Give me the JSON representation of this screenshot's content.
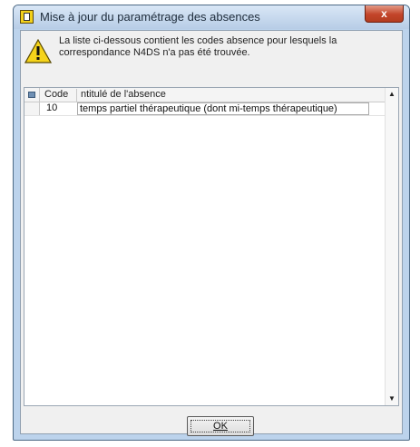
{
  "window": {
    "title": "Mise à jour du paramétrage des absences",
    "close_label": "x",
    "icons": {
      "app": "app-notepad-icon",
      "warning": "warning-icon"
    }
  },
  "message": {
    "line1": "La liste ci-dessous contient les codes absence pour lesquels la",
    "line2": "correspondance N4DS n'a pas été trouvée."
  },
  "grid": {
    "columns": {
      "code": "Code",
      "label": "ntitulé de l'absence"
    },
    "rows": [
      {
        "code": "10",
        "label": "temps partiel thérapeutique (dont mi-temps thérapeutique)"
      }
    ]
  },
  "buttons": {
    "ok": "OK"
  },
  "colors": {
    "title_bg": "#bcd3ec",
    "close_btn": "#c3452a",
    "warning": "#f5d31a"
  }
}
